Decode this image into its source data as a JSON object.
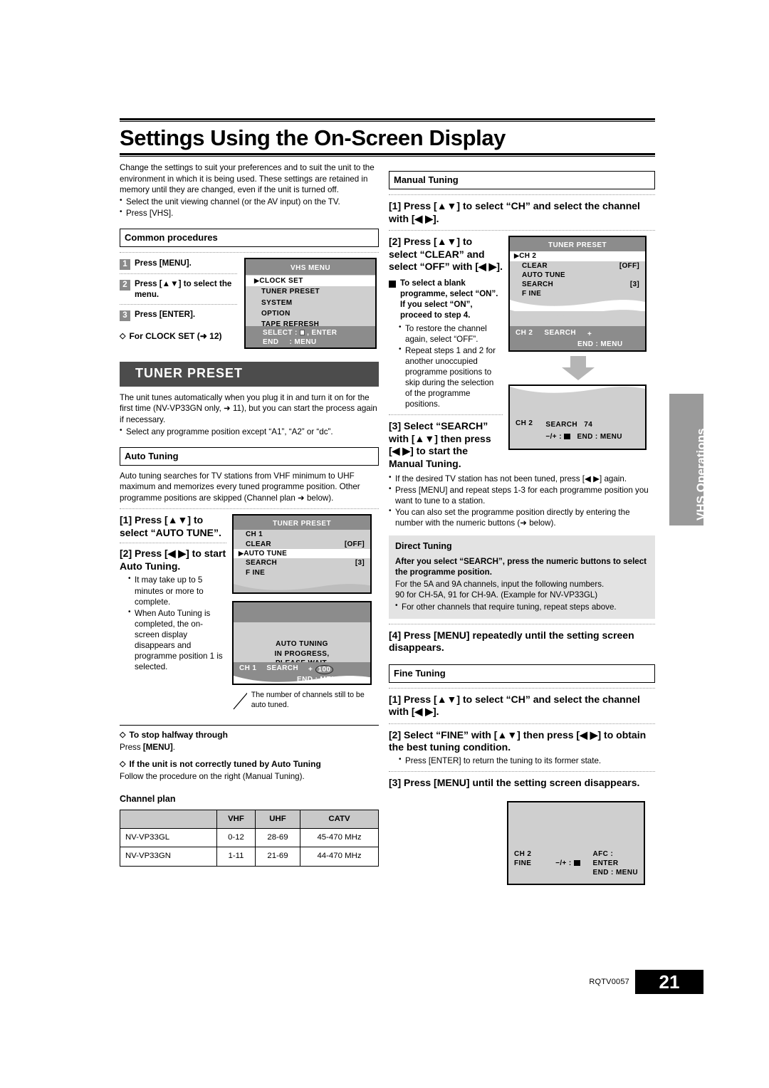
{
  "page": {
    "title": "Settings Using the On-Screen Display",
    "side_tab": "VHS Operations",
    "footer_code": "RQTV0057",
    "page_number": "21"
  },
  "intro": {
    "paragraph": "Change the settings to suit your preferences and to suit the unit to the environment in which it is being used. These settings are retained in memory until they are changed, even if the unit is turned off.",
    "bullets": [
      "Select the unit viewing channel (or the AV input) on the TV.",
      "Press [VHS]."
    ]
  },
  "common_procedures": {
    "heading": "Common procedures",
    "steps": [
      {
        "num": "1",
        "text": "Press [MENU]."
      },
      {
        "num": "2",
        "text": "Press [▲▼] to select the menu."
      },
      {
        "num": "3",
        "text": "Press [ENTER]."
      }
    ],
    "note": "For CLOCK SET (➜ 12)"
  },
  "vhs_menu_screen": {
    "title": "VHS MENU",
    "items": [
      "CLOCK SET",
      "TUNER PRESET",
      "SYSTEM",
      "OPTION",
      "TAPE REFRESH"
    ],
    "selected": "CLOCK SET",
    "footer_line1": "SELECT :",
    "footer_line1_tail": ", ENTER",
    "footer_line2_label": "END",
    "footer_line2_value": ": MENU"
  },
  "tuner_preset": {
    "band_title": "TUNER PRESET",
    "paragraph": "The unit tunes automatically when you plug it in and turn it on for the first time (NV-VP33GN only, ➜ 11), but you can start the process again if necessary.",
    "bullets": [
      "Select any programme position except “A1”, “A2” or “dc”."
    ]
  },
  "auto_tuning": {
    "heading": "Auto Tuning",
    "paragraph": "Auto tuning searches for TV stations from VHF minimum to UHF maximum and memorizes every tuned programme position. Other programme positions are skipped (Channel plan ➜ below).",
    "step1": "[1] Press [▲▼] to select “AUTO TUNE”.",
    "step2": "[2] Press [◀ ▶] to start Auto Tuning.",
    "step2_bullets": [
      "It may take up to 5 minutes or more to complete.",
      "When Auto Tuning is completed, the on-screen display disappears and programme position 1 is selected."
    ],
    "callout": "The number of channels still to be auto tuned.",
    "stop_heading": "To stop halfway through",
    "stop_text_prefix": "Press ",
    "stop_text_key": "[MENU]",
    "stop_text_suffix": ".",
    "nottuned_heading": "If the unit is not correctly tuned by Auto Tuning",
    "nottuned_text": "Follow the procedure on the right (Manual Tuning)."
  },
  "screens": {
    "tuner_preset_auto": {
      "title": "TUNER PRESET",
      "rows": [
        {
          "label": "CH 1",
          "value": "",
          "selected": false,
          "arrow": false
        },
        {
          "label": "CLEAR",
          "value": "[OFF]",
          "selected": false,
          "arrow": false
        },
        {
          "label": "AUTO  TUNE",
          "value": "",
          "selected": true,
          "arrow": true
        },
        {
          "label": "SEARCH",
          "value": "[3]",
          "selected": false,
          "arrow": false
        },
        {
          "label": "F INE",
          "value": "",
          "selected": false,
          "arrow": false
        }
      ]
    },
    "auto_tuning_progress": {
      "lines": [
        "AUTO  TUNING",
        "IN PROGRESS,",
        "PLEASE  WAIT."
      ],
      "footer_ch": "CH  1",
      "footer_search": "SEARCH",
      "footer_count": "100",
      "footer_pm": "+",
      "footer_end": "END : MENU"
    },
    "tuner_preset_manual": {
      "title": "TUNER PRESET",
      "rows": [
        {
          "label": "CH  2",
          "value": "",
          "selected": true,
          "arrow": true
        },
        {
          "label": "CLEAR",
          "value": "[OFF]",
          "selected": false,
          "arrow": false
        },
        {
          "label": "AUTO  TUNE",
          "value": "",
          "selected": false,
          "arrow": false
        },
        {
          "label": "SEARCH",
          "value": "[3]",
          "selected": false,
          "arrow": false
        },
        {
          "label": "F INE",
          "value": "",
          "selected": false,
          "arrow": false
        }
      ],
      "footer_ch": "CH  2",
      "footer_search": "SEARCH",
      "footer_pm": "+",
      "footer_end": "END : MENU"
    },
    "search_result": {
      "footer_ch": "CH  2",
      "footer_search": "SEARCH",
      "footer_value": "74",
      "footer_pm": "−/+ :",
      "footer_end": "END : MENU"
    },
    "fine_tuning": {
      "footer_ch": "CH  2",
      "footer_label": "FINE",
      "footer_pm": "−/+ :",
      "footer_afc": "AFC : ENTER",
      "footer_end": "END : MENU"
    }
  },
  "channel_plan": {
    "heading": "Channel plan",
    "columns": [
      "",
      "VHF",
      "UHF",
      "CATV"
    ],
    "rows": [
      [
        "NV-VP33GL",
        "0-12",
        "28-69",
        "45-470 MHz"
      ],
      [
        "NV-VP33GN",
        "1-11",
        "21-69",
        "44-470 MHz"
      ]
    ]
  },
  "manual_tuning": {
    "heading": "Manual Tuning",
    "step1": "[1] Press [▲▼] to select “CH” and select the channel with [◀ ▶].",
    "step2": "[2] Press [▲▼] to select “CLEAR” and select “OFF” with [◀ ▶].",
    "blank_note": "To select a blank programme, select “ON”. If you select “ON”, proceed to step 4.",
    "blank_bullets": [
      "To restore the channel again, select “OFF”.",
      "Repeat steps 1 and 2 for another unoccupied programme positions to skip during the selection of the programme positions."
    ],
    "step3": "[3] Select “SEARCH” with [▲▼] then press [◀ ▶] to start the Manual Tuning.",
    "step3_bullets": [
      "If the desired TV station has not been tuned, press [◀ ▶] again.",
      "Press [MENU] and repeat steps 1-3 for each programme position you want to tune to a station.",
      "You can also set the programme position directly by entering the number with the numeric buttons (➜ below)."
    ],
    "step4": "[4] Press [MENU] repeatedly until the setting screen disappears."
  },
  "direct_tuning": {
    "heading": "Direct Tuning",
    "bold_text": "After you select “SEARCH”, press the numeric buttons to select the programme position.",
    "line1": "For the 5A and 9A channels, input the following numbers.",
    "line2": "90 for CH-5A, 91 for CH-9A. (Example for NV-VP33GL)",
    "bullets": [
      "For other channels that require tuning, repeat steps above."
    ]
  },
  "fine_tuning": {
    "heading": "Fine Tuning",
    "step1": "[1] Press [▲▼] to select “CH” and select the channel with [◀ ▶].",
    "step2": "[2] Select “FINE” with [▲▼] then press [◀ ▶] to obtain the best tuning condition.",
    "step2_bullets": [
      "Press [ENTER] to return the tuning to its former state."
    ],
    "step3": "[3] Press [MENU] until the setting screen disappears."
  }
}
